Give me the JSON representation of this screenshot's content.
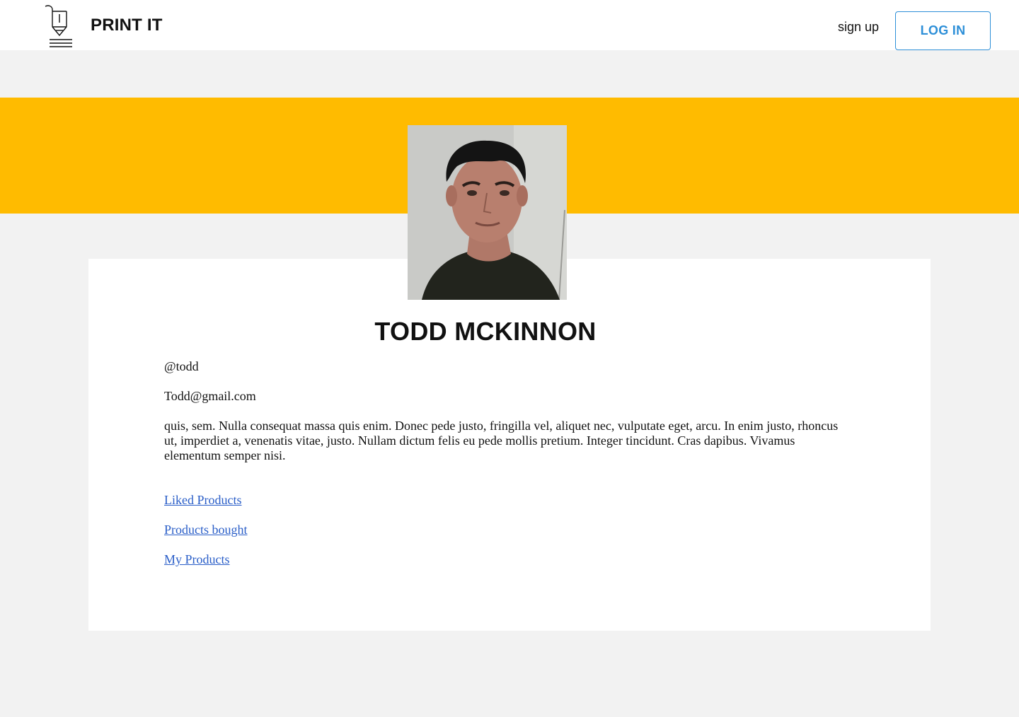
{
  "header": {
    "logo_icon": "3d-printer-nozzle-icon",
    "brand": "PRINT IT",
    "signup_label": "sign up",
    "login_label": "LOG IN"
  },
  "colors": {
    "banner": "#ffbb00",
    "accent": "#2d8fd8",
    "link": "#2a5ec8",
    "page_bg": "#f2f2f2"
  },
  "profile": {
    "avatar": "profile-photo",
    "name": "TODD MCKINNON",
    "handle": "@todd",
    "email": "Todd@gmail.com",
    "bio": "quis, sem. Nulla consequat massa quis enim. Donec pede justo, fringilla vel, aliquet nec, vulputate eget, arcu. In enim justo, rhoncus ut, imperdiet a, venenatis vitae, justo. Nullam dictum felis eu pede mollis pretium. Integer tincidunt. Cras dapibus. Vivamus elementum semper nisi.",
    "links": [
      "Liked Products",
      "Products bought",
      "My Products"
    ]
  }
}
